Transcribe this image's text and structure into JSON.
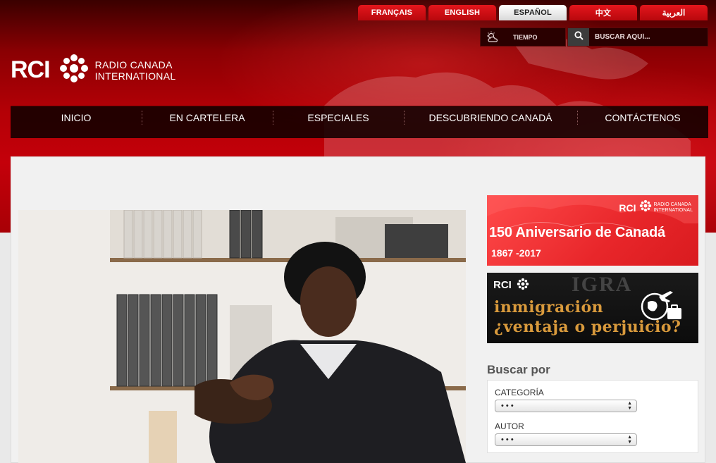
{
  "languages": [
    {
      "label": "FRANÇAIS",
      "active": false
    },
    {
      "label": "ENGLISH",
      "active": false
    },
    {
      "label": "ESPAÑOL",
      "active": true
    },
    {
      "label": "中文",
      "active": false
    },
    {
      "label": "العربية",
      "active": false
    }
  ],
  "weather": {
    "label": "TIEMPO",
    "icon": "cloud-sun-icon"
  },
  "search": {
    "placeholder": "BUSCAR AQUÍ...",
    "icon": "search-icon"
  },
  "logo": {
    "short": "RCI",
    "line1": "RADIO CANADA",
    "line2": "INTERNATIONAL"
  },
  "nav": {
    "items": [
      {
        "label": "INICIO"
      },
      {
        "label": "EN CARTELERA"
      },
      {
        "label": "ESPECIALES"
      },
      {
        "label": "DESCUBRIENDO CANADÁ"
      },
      {
        "label": "CONTÁCTENOS"
      }
    ]
  },
  "banners": {
    "anniversary": {
      "brand_short": "RCI",
      "brand_line1": "RADIO CANADA",
      "brand_line2": "INTERNATIONAL",
      "title": "150 Aniversario de Canadá",
      "years": "1867 -2017"
    },
    "immigration": {
      "brand_short": "RCI",
      "stamp": "IGRA",
      "line1": "inmigración",
      "line2": "¿ventaja o perjuicio?"
    }
  },
  "search_by": {
    "title": "Buscar por",
    "category_label": "CATEGORÍA",
    "category_value": "• • •",
    "author_label": "AUTOR",
    "author_value": "• • •"
  },
  "colors": {
    "brand_red": "#c4000a",
    "accent_gold": "#d99a3c"
  }
}
